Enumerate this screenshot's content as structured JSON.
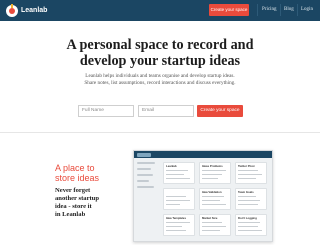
{
  "nav": {
    "logo": "Leanlab",
    "cta": "Create your space",
    "links": [
      "Pricing",
      "Blog",
      "Login"
    ]
  },
  "hero": {
    "title_line1": "A personal space to record and",
    "title_line2": "develop your startup ideas",
    "subtitle_line1": "Leanlab helps individuals and teams organise and develop startup ideas.",
    "subtitle_line2": "Share notes, list assumptions, record interactions and discuss everything.",
    "name_placeholder": "Full Name",
    "email_placeholder": "Email",
    "cta": "Create your space"
  },
  "feature": {
    "title_line1": "A place to",
    "title_line2": "store ideas",
    "text_line1": "Never forget",
    "text_line2": "another startup",
    "text_line3": "idea - store it",
    "text_line4": "in Leanlab"
  },
  "screenshot": {
    "cards": [
      "Leanlab",
      "Ideas Problems",
      "Twitter Pivot",
      "",
      "Idea Validation",
      "Team Goals",
      "",
      "Idea Templates",
      "Market Size",
      "Don't Logging"
    ]
  },
  "colors": {
    "nav_bg": "#1b4663",
    "accent": "#e94b3c"
  }
}
